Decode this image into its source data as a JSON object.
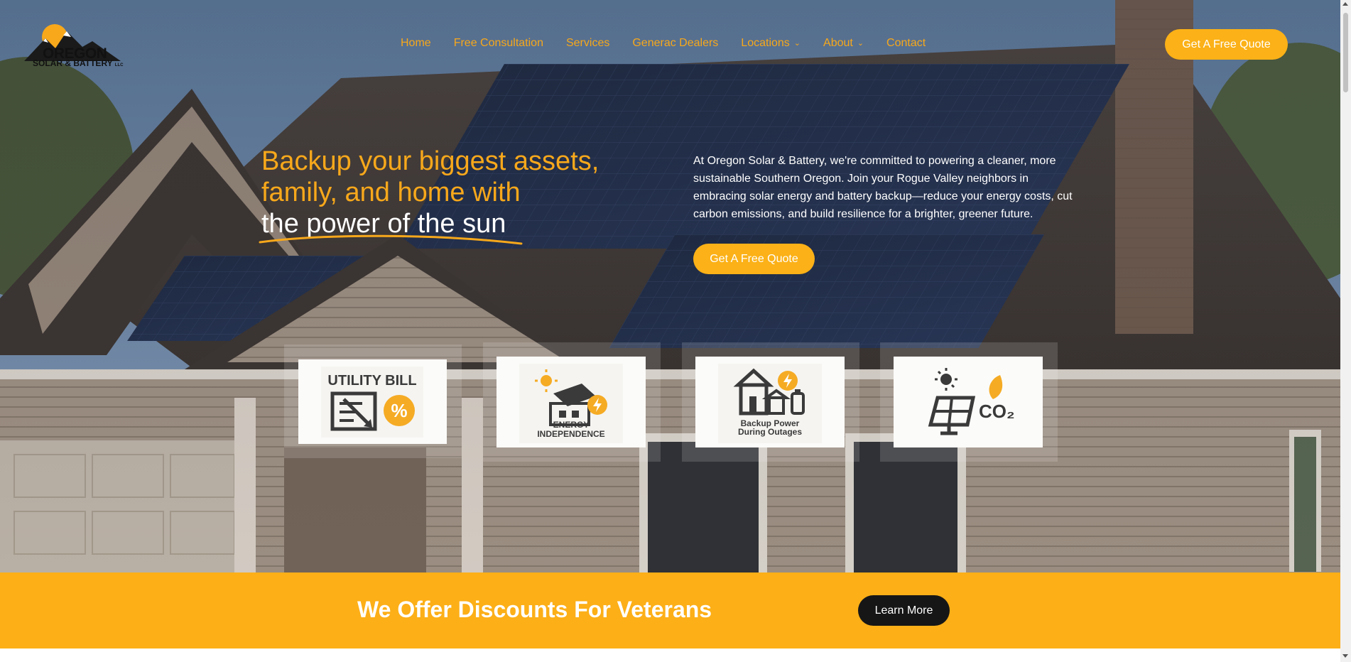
{
  "brand": {
    "logo_line1": "OREGON",
    "logo_line2": "SOLAR & BATTERY",
    "logo_llc": "LLC"
  },
  "nav": {
    "items": [
      {
        "label": "Home",
        "dropdown": false
      },
      {
        "label": "Free Consultation",
        "dropdown": false
      },
      {
        "label": "Services",
        "dropdown": false
      },
      {
        "label": "Generac Dealers",
        "dropdown": false
      },
      {
        "label": "Locations",
        "dropdown": true
      },
      {
        "label": "About",
        "dropdown": true
      },
      {
        "label": "Contact",
        "dropdown": false
      }
    ],
    "cta_label": "Get A Free Quote"
  },
  "hero": {
    "headline_line1": "Backup your biggest assets,",
    "headline_line2": "family, and home with",
    "headline_line3": "the power of the sun",
    "intro": "At Oregon Solar & Battery, we're committed to powering a cleaner, more sustainable Southern Oregon. Join your Rogue Valley neighbors in embracing solar energy and battery backup—reduce your energy costs, cut carbon emissions, and build resilience for a brighter, greener future.",
    "cta_label": "Get A Free Quote"
  },
  "features": [
    {
      "label": "UTILITY BILL",
      "icon": "utility-bill-percent-icon"
    },
    {
      "label_line1": "ENERGY",
      "label_line2": "INDEPENDENCE",
      "icon": "house-solar-panel-icon"
    },
    {
      "label_line1": "Backup Power",
      "label_line2": "During Outages",
      "icon": "house-battery-icon"
    },
    {
      "label": "CO₂",
      "icon": "solar-panel-co2-leaf-icon"
    }
  ],
  "banner": {
    "text": "We Offer Discounts For Veterans",
    "button_label": "Learn More"
  },
  "colors": {
    "accent": "#fbb117",
    "accent_text": "#f7a81b",
    "banner": "#fcaf17",
    "dark_button": "#161616",
    "icon_dark": "#3a3a3a"
  }
}
